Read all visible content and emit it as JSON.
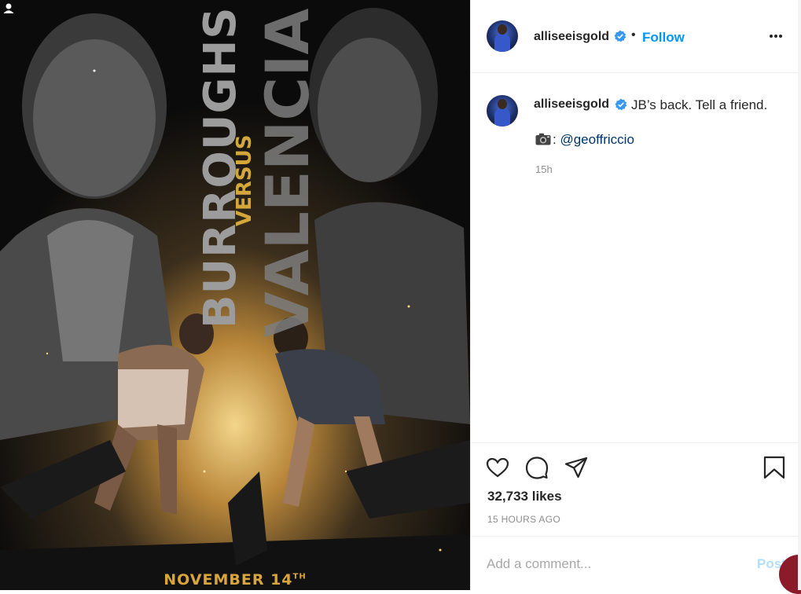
{
  "post": {
    "image": {
      "name_left": "BURROUGHS",
      "versus": "VERSUS",
      "name_right": "VALENCIA",
      "date_main": "NOVEMBER 14",
      "date_suffix": "TH",
      "tag_icon": "user-tag-icon"
    }
  },
  "header": {
    "username": "alliseeisgold",
    "verified_icon": "verified-badge-icon",
    "separator": "•",
    "follow_label": "Follow",
    "more_icon": "more-options-icon"
  },
  "caption": {
    "username": "alliseeisgold",
    "text": "JB’s back. Tell a friend.",
    "credit_prefix": ":",
    "credit_handle": "@geoffriccio",
    "camera_icon": "camera-icon",
    "time": "15h"
  },
  "actions": {
    "like_icon": "heart-icon",
    "comment_icon": "comment-icon",
    "share_icon": "paper-plane-icon",
    "save_icon": "bookmark-icon",
    "likes": "32,733 likes",
    "timestamp": "15 HOURS AGO"
  },
  "comment": {
    "placeholder": "Add a comment...",
    "post_label": "Post"
  },
  "colors": {
    "accent": "#0095f6",
    "gold": "#d8a63a",
    "text": "#262626",
    "muted": "#8e8e8e"
  }
}
